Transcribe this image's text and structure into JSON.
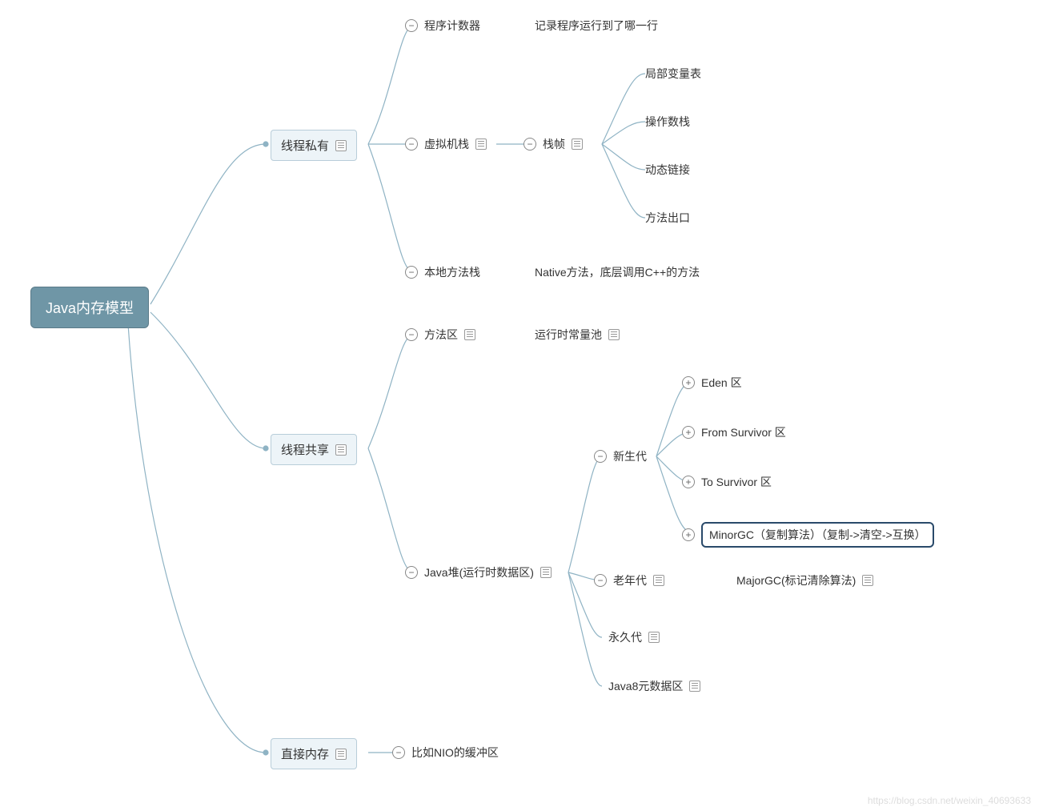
{
  "root": {
    "label": "Java内存模型"
  },
  "private": {
    "label": "线程私有",
    "children": {
      "pc": {
        "label": "程序计数器",
        "desc": "记录程序运行到了哪一行"
      },
      "vmstack": {
        "label": "虚拟机栈",
        "frame": {
          "label": "栈帧",
          "children": {
            "locals": "局部变量表",
            "opstack": "操作数栈",
            "dynlink": "动态链接",
            "exit": "方法出口"
          }
        }
      },
      "native": {
        "label": "本地方法栈",
        "desc": "Native方法，底层调用C++的方法"
      }
    }
  },
  "shared": {
    "label": "线程共享",
    "children": {
      "method_area": {
        "label": "方法区",
        "desc": "运行时常量池"
      },
      "heap": {
        "label": "Java堆(运行时数据区)",
        "children": {
          "young": {
            "label": "新生代",
            "children": {
              "eden": "Eden 区",
              "from": "From Survivor 区",
              "to": "To Survivor 区",
              "minorgc": "MinorGC（复制算法）（复制->清空->互换）"
            }
          },
          "old": {
            "label": "老年代",
            "desc": "MajorGC(标记清除算法)"
          },
          "perm": {
            "label": "永久代"
          },
          "meta": {
            "label": "Java8元数据区"
          }
        }
      }
    }
  },
  "direct": {
    "label": "直接内存",
    "desc": "比如NIO的缓冲区"
  },
  "watermark": "https://blog.csdn.net/weixin_40693633"
}
